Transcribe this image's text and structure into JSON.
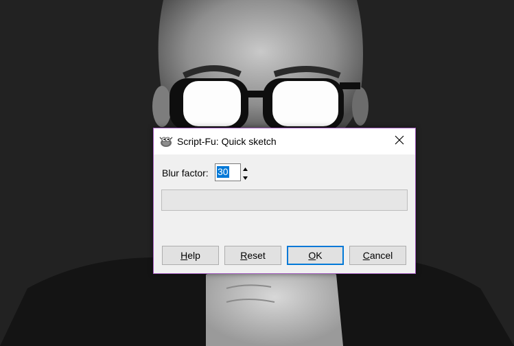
{
  "dialog": {
    "title": "Script-Fu: Quick sketch",
    "app_icon": "gimp-wilber-icon",
    "close_icon": "close-icon"
  },
  "form": {
    "blur_label": "Blur factor:",
    "blur_value": "30"
  },
  "progress": {
    "fraction": 0
  },
  "buttons": {
    "help_mnemonic": "H",
    "help_rest": "elp",
    "reset_mnemonic": "R",
    "reset_rest": "eset",
    "ok_mnemonic": "O",
    "ok_rest": "K",
    "cancel_mnemonic": "C",
    "cancel_rest": "ancel"
  },
  "colors": {
    "dialog_border": "#a35bc0",
    "selection": "#0078d7",
    "default_button_border": "#0078d7"
  }
}
